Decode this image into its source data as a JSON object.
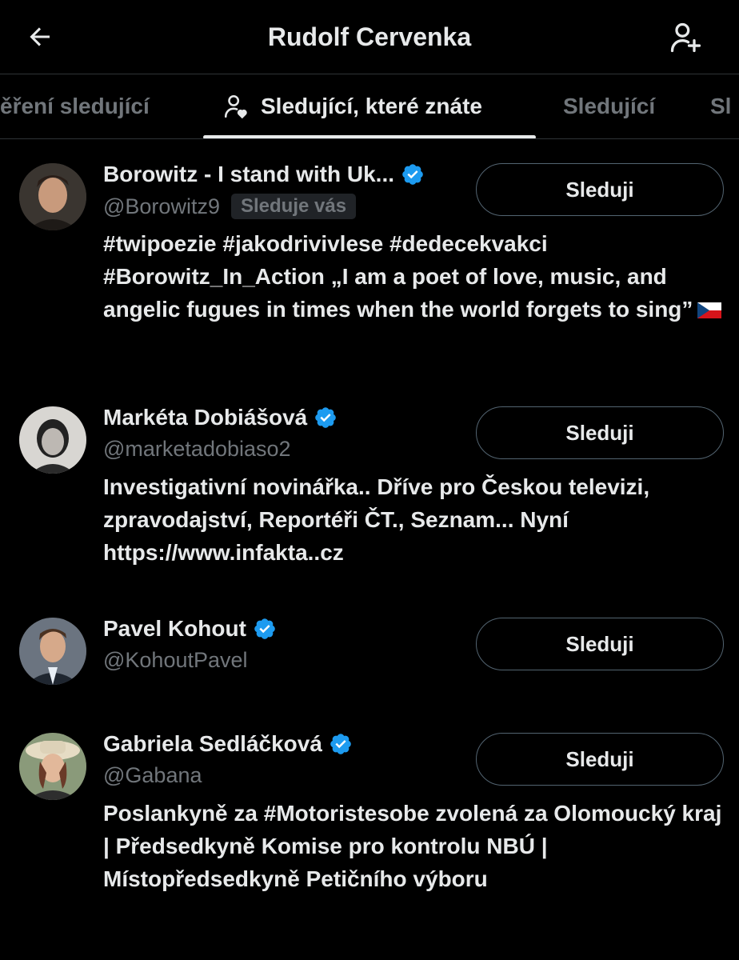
{
  "header": {
    "title": "Rudolf Cervenka",
    "back_icon": "arrow-left-icon",
    "add_icon": "person-add-icon"
  },
  "tabs": [
    {
      "label": "ěření sledující",
      "active": false
    },
    {
      "label": "Sledující, které znáte",
      "active": true,
      "icon": "person-heart-icon"
    },
    {
      "label": "Sledující",
      "active": false
    },
    {
      "label": "Sl",
      "active": false
    }
  ],
  "users": [
    {
      "name": "Borowitz - I stand with Uk...",
      "handle": "@Borowitz9",
      "badge": "Sleduje vás",
      "verified": true,
      "button": "Sleduji",
      "bio": "#twipoezie #jakodrivivlese #dedecekvakci #Borowitz_In_Action „I am a poet of love, music, and angelic fugues in times when the world forgets to sing”"
    },
    {
      "name": "Markéta Dobiášová",
      "handle": "@marketadobiaso2",
      "verified": true,
      "button": "Sleduji",
      "bio": "Investigativní novinářka.. Dříve pro Českou televizi, zpravodajství, Reportéři ČT., Seznam... Nyní https://www.infakta..cz"
    },
    {
      "name": "Pavel Kohout",
      "handle": "@KohoutPavel",
      "verified": true,
      "button": "Sleduji",
      "bio": ""
    },
    {
      "name": "Gabriela Sedláčková",
      "handle": "@Gabana",
      "verified": true,
      "button": "Sleduji",
      "bio": "Poslankyně za #Motoristesobe zvolená za Olomoucký kraj | Předsedkyně Komise pro kontrolu NBÚ | Místopředsedkyně Petičního výboru"
    }
  ],
  "colors": {
    "background": "#000000",
    "text": "#e7e9ea",
    "muted": "#71767b",
    "verified": "#1d9bf0",
    "border": "#2f3336"
  }
}
